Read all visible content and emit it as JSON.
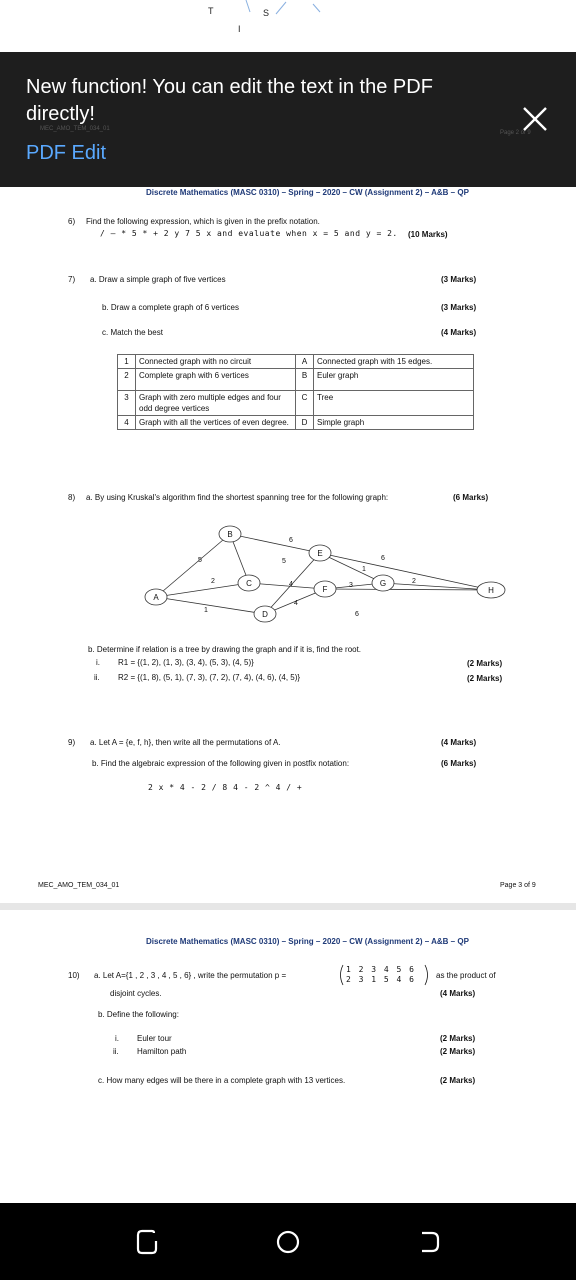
{
  "peek": {
    "chars": [
      "T",
      "S",
      "I"
    ]
  },
  "banner": {
    "message": "New function! You can edit the text in the PDF directly!",
    "link": "PDF Edit",
    "ghost_left": "MEC_AMO_TEM_034_01",
    "ghost_right": "Page 2 of 9"
  },
  "page1": {
    "header": "Discrete Mathematics (MASC 0310) – Spring – 2020 – CW (Assignment 2) – A&B – QP",
    "q6": {
      "num": "6)",
      "text": "Find the following expression, which is given in the prefix notation.",
      "expr": "/ – * 5 * + 2  y  7  5  x  and evaluate when  x = 5  and  y = 2.",
      "marks": "(10 Marks)"
    },
    "q7": {
      "num": "7)",
      "a": "a.  Draw a simple graph of five vertices",
      "a_marks": "(3 Marks)",
      "b": "b.  Draw a complete graph of 6 vertices",
      "b_marks": "(3 Marks)",
      "c": "c.  Match the best",
      "c_marks": "(4 Marks)",
      "table": [
        {
          "n": "1",
          "left": "Connected graph with no circuit",
          "k": "A",
          "right": "Connected graph with 15 edges."
        },
        {
          "n": "2",
          "left": "Complete graph with 6 vertices",
          "k": "B",
          "right": "Euler graph"
        },
        {
          "n": "3",
          "left": "Graph with zero multiple edges and four odd degree vertices",
          "k": "C",
          "right": "Tree"
        },
        {
          "n": "4",
          "left": "Graph with all the vertices of even degree.",
          "k": "D",
          "right": "Simple graph"
        }
      ]
    },
    "q8": {
      "num": "8)",
      "a": "a.  By using Kruskal's algorithm find the shortest spanning tree for the following graph:",
      "a_marks": "(6 Marks)",
      "graph": {
        "vertices": [
          "A",
          "B",
          "C",
          "D",
          "E",
          "F",
          "G",
          "H"
        ],
        "weights": [
          "5",
          "6",
          "5",
          "2",
          "4",
          "1",
          "6",
          "3",
          "2",
          "1",
          "4",
          "6"
        ]
      },
      "b": "b.  Determine if relation is a tree by drawing the graph and if it is, find the root.",
      "b_i_num": "i.",
      "b_i": "R1 = {(1, 2), (1, 3), (3, 4), (5, 3), (4, 5)}",
      "b_i_marks": "(2 Marks)",
      "b_ii_num": "ii.",
      "b_ii": "R2 = {(1, 8), (5, 1), (7, 3), (7, 2), (7, 4), (4, 6), (4, 5)}",
      "b_ii_marks": "(2 Marks)"
    },
    "q9": {
      "num": "9)",
      "a": "a.  Let A = {e, f, h}, then write all the permutations of A.",
      "a_marks": "(4 Marks)",
      "b": "b.  Find the algebraic expression of the following given in postfix notation:",
      "b_marks": "(6 Marks)",
      "expr": "2  x * 4 - 2 / 8   4 -  2 ^ 4 / +"
    },
    "footer_left": "MEC_AMO_TEM_034_01",
    "footer_right": "Page 3 of 9"
  },
  "page2": {
    "header": "Discrete Mathematics (MASC 0310) – Spring – 2020 – CW (Assignment 2) – A&B – QP",
    "q10": {
      "num": "10)",
      "a_pre": "a.  Let A={1 , 2 , 3 , 4 , 5 , 6} , write the permutation  p =",
      "perm_top": "1  2  3  4  5  6",
      "perm_bottom": "2  3  1  5  4  6",
      "a_post": "as the product of",
      "a_line2": "disjoint cycles.",
      "a_marks": "(4 Marks)",
      "b": "b.  Define the following:",
      "b_i_num": "i.",
      "b_i": "Euler tour",
      "b_i_marks": "(2 Marks)",
      "b_ii_num": "ii.",
      "b_ii": "Hamilton path",
      "b_ii_marks": "(2 Marks)",
      "c": "c.  How many edges will be there in a complete graph with 13 vertices.",
      "c_marks": "(2 Marks)"
    }
  },
  "colors": {
    "banner_bg": "#1e1e1e",
    "link": "#5aa9ff",
    "header_text": "#1f3a78",
    "nav_bg": "#000000"
  },
  "navbar": {
    "icons": [
      "recent-apps-icon",
      "home-icon",
      "back-icon"
    ]
  }
}
